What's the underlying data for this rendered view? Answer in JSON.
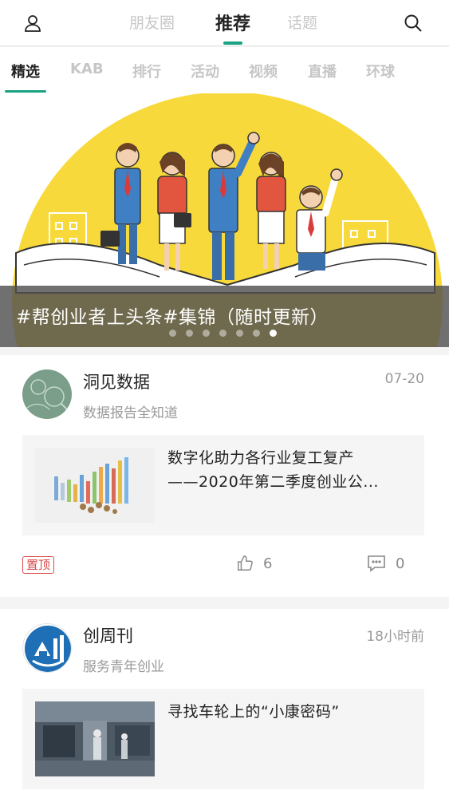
{
  "header": {
    "tabs": [
      {
        "label": "朋友圈",
        "active": false
      },
      {
        "label": "推荐",
        "active": true
      },
      {
        "label": "话题",
        "active": false
      }
    ],
    "icons": {
      "left": "user-icon",
      "right": "search-icon"
    }
  },
  "categories": [
    {
      "label": "精选",
      "active": true
    },
    {
      "label": "KAB",
      "active": false
    },
    {
      "label": "排行",
      "active": false
    },
    {
      "label": "活动",
      "active": false
    },
    {
      "label": "视频",
      "active": false
    },
    {
      "label": "直播",
      "active": false
    },
    {
      "label": "环球",
      "active": false
    }
  ],
  "banner": {
    "caption": "#帮创业者上头条#集锦（随时更新）",
    "dot_count": 7,
    "active_dot": 6
  },
  "feed": [
    {
      "account": "洞见数据",
      "description": "数据报告全知道",
      "time": "07-20",
      "title_line1": "数字化助力各行业复工复产",
      "title_line2": "——2020年第二季度创业公...",
      "pinned_label": "置顶",
      "likes": "6",
      "comments": "0"
    },
    {
      "account": "创周刊",
      "description": "服务青年创业",
      "time": "18小时前",
      "title_line1": "寻找车轮上的“小康密码”"
    }
  ],
  "colors": {
    "accent": "#19a383",
    "banner_yellow": "#f8d93c",
    "pin_red": "#d94b4b"
  }
}
